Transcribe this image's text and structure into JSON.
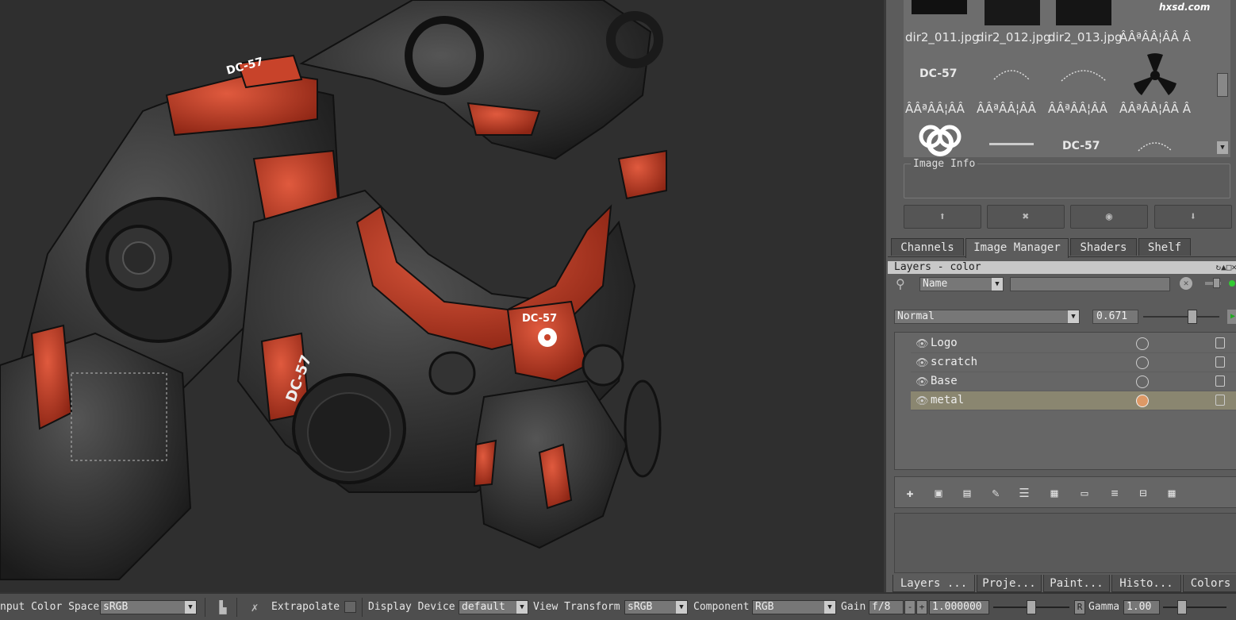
{
  "image_manager": {
    "captions_row1": [
      "dir2_011.jpg",
      "dir2_012.jpg",
      "dir2_013.jpg",
      "ÂÂªÂÂ¦ÂÂ Â"
    ],
    "thumbs_row2": [
      "DC-57",
      "",
      "",
      ""
    ],
    "captions_row3": [
      "ÂÂªÂÂ¦ÂÂ",
      "ÂÂªÂÂ¦ÂÂ",
      "ÂÂªÂÂ¦ÂÂ",
      "ÂÂªÂÂ¦ÂÂ Â"
    ],
    "thumbs_row4": [
      "",
      "",
      "DC-57",
      ""
    ],
    "image_info_label": "Image Info"
  },
  "watermark": "hxsd.com",
  "tabs_top": [
    "Channels",
    "Image Manager",
    "Shaders",
    "Shelf"
  ],
  "layers_panel": {
    "title": "Layers - color",
    "filter_select": "Name",
    "blend_mode": "Normal",
    "opacity": "0.671",
    "layers": [
      {
        "name": "Logo",
        "selected": false
      },
      {
        "name": "scratch",
        "selected": false
      },
      {
        "name": "Base",
        "selected": false
      },
      {
        "name": "metal",
        "selected": true
      }
    ]
  },
  "tabs_bottom": [
    "Layers ...",
    "Proje...",
    "Paint...",
    "Histo...",
    "Colors"
  ],
  "toolbar": {
    "input_color_space_label": "nput Color Space",
    "input_color_space_value": "sRGB",
    "extrapolate_label": "Extrapolate",
    "display_device_label": "Display Device",
    "display_device_value": "default",
    "view_transform_label": "View Transform",
    "view_transform_value": "sRGB",
    "component_label": "Component",
    "component_value": "RGB",
    "gain_label": "Gain",
    "gain_unit": "f/8",
    "gain_minus": "-",
    "gain_plus": "+",
    "gain_value": "1.000000",
    "r_label": "R",
    "gamma_label": "Gamma",
    "gamma_value": "1.00"
  },
  "viewport": {
    "decals": [
      "DC-57",
      "DC-57",
      "DC-57"
    ]
  },
  "colors": {
    "armor_red": "#c8432a",
    "armor_dark": "#2a2a2a",
    "viewport_bg": "#2f2f2f",
    "panel_bg": "#5c5c5c",
    "selected_layer": "#8a8670",
    "accent_green": "#33cc33"
  }
}
